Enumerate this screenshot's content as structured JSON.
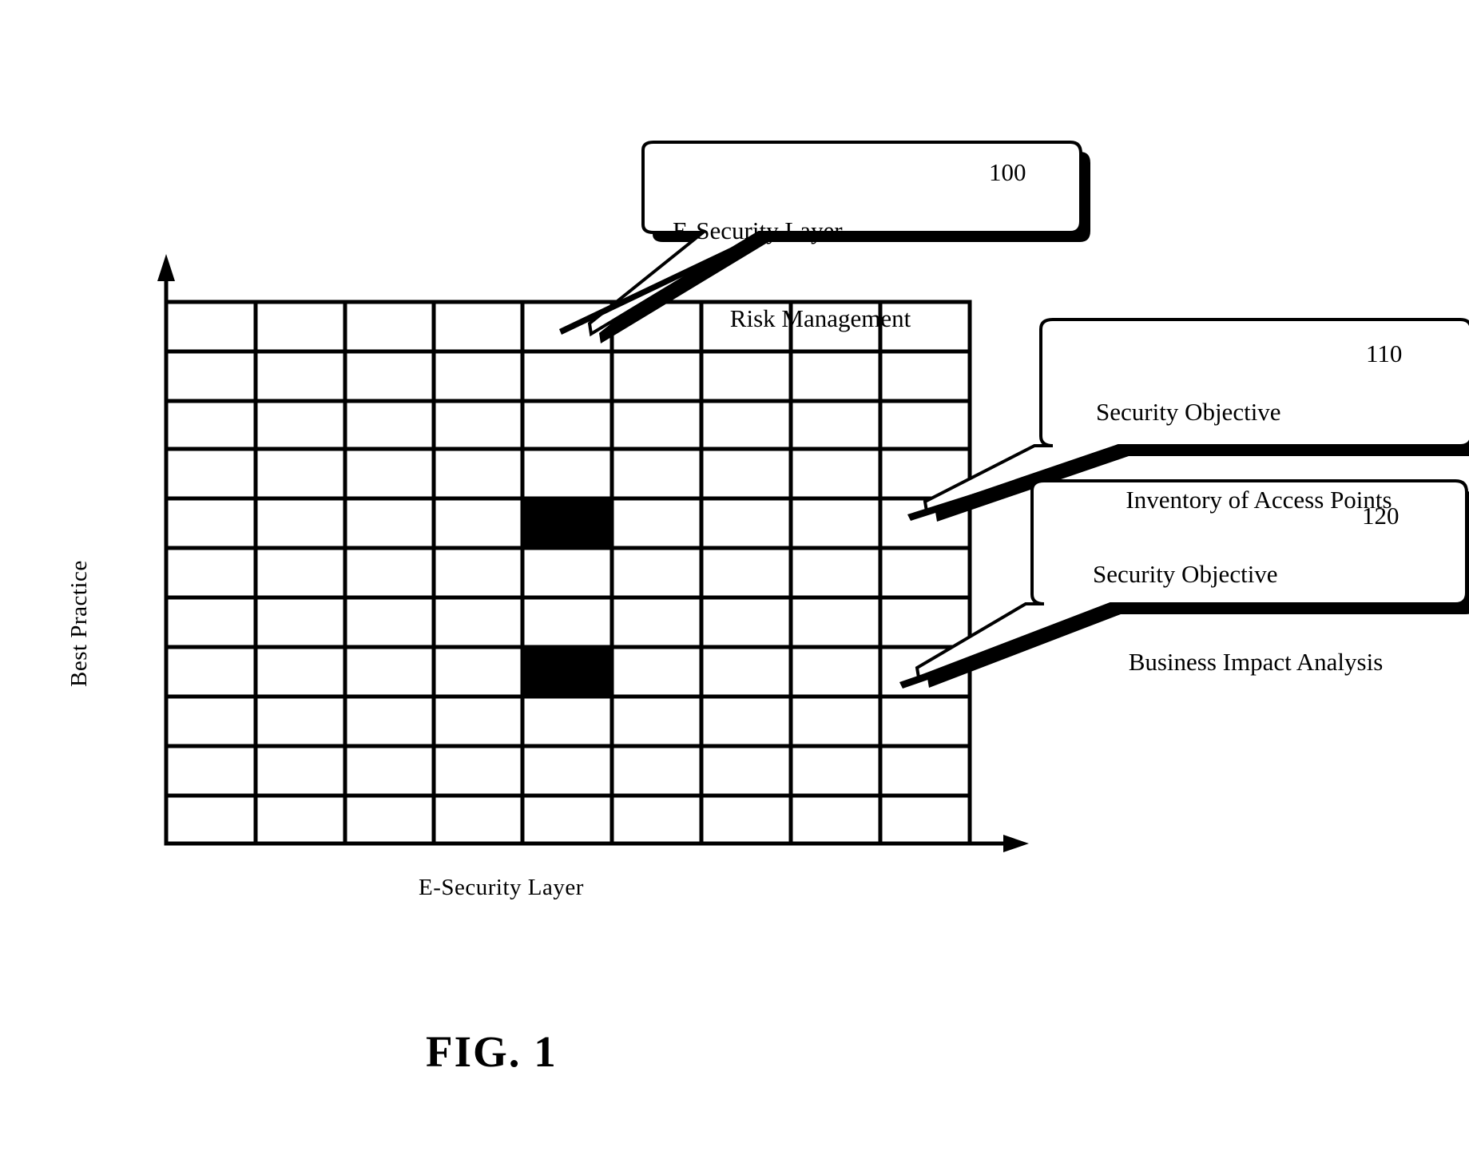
{
  "figure": {
    "caption": "FIG. 1",
    "axes": {
      "y_label": "Best Practice",
      "x_label": "E-Security Layer"
    },
    "grid": {
      "columns": 9,
      "rows": 11,
      "filled_cells": [
        {
          "row": 5,
          "col": 5
        },
        {
          "row": 8,
          "col": 5
        }
      ],
      "cell_fill_color": "#000000",
      "cell_empty_color": "#ffffff",
      "line_color": "#000000"
    },
    "callouts": [
      {
        "id": "callout-100",
        "line1": "E-Security Layer",
        "line2": "Risk Management",
        "ref": "100"
      },
      {
        "id": "callout-110",
        "line1": "Security Objective",
        "line2": "Inventory of Access Points",
        "ref": "110"
      },
      {
        "id": "callout-120",
        "line1": "Security Objective",
        "line2": "Business Impact Analysis",
        "ref": "120"
      }
    ]
  }
}
